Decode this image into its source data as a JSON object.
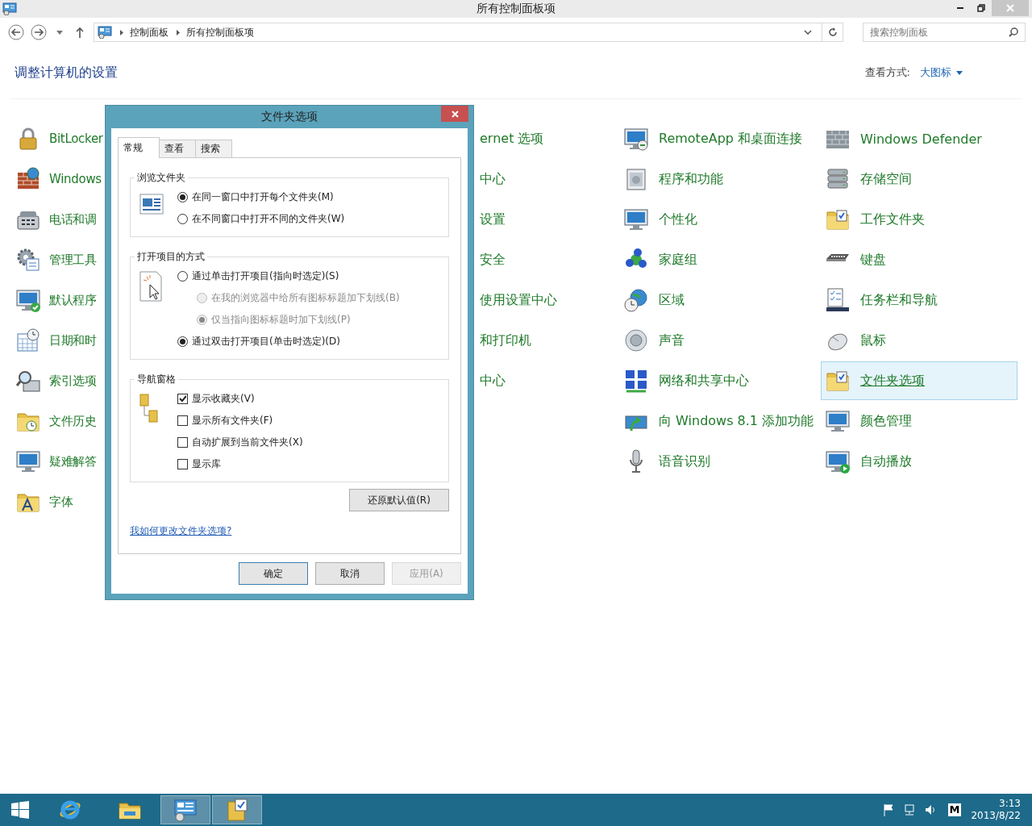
{
  "window": {
    "title": "所有控制面板项"
  },
  "navigation": {
    "breadcrumb": [
      "控制面板",
      "所有控制面板项"
    ],
    "search": {
      "placeholder": "搜索控制面板"
    }
  },
  "header": {
    "title": "调整计算机的设置",
    "view_label": "查看方式:",
    "view_value": "大图标"
  },
  "columns": [
    {
      "items": [
        {
          "label": "BitLocker",
          "selected": false
        },
        {
          "label": "Windows",
          "selected": false
        },
        {
          "label": "电话和调",
          "selected": false
        },
        {
          "label": "管理工具",
          "selected": false
        },
        {
          "label": "默认程序",
          "selected": false
        },
        {
          "label": "日期和时",
          "selected": false
        },
        {
          "label": "索引选项",
          "selected": false
        },
        {
          "label": "文件历史",
          "selected": false
        },
        {
          "label": "疑难解答",
          "selected": false
        },
        {
          "label": "字体",
          "selected": false
        }
      ]
    },
    {
      "items": [
        {
          "label": "ernet 选项",
          "selected": false
        },
        {
          "label": "中心",
          "selected": false
        },
        {
          "label": "设置",
          "selected": false
        },
        {
          "label": "安全",
          "selected": false
        },
        {
          "label": "使用设置中心",
          "selected": false
        },
        {
          "label": "和打印机",
          "selected": false
        },
        {
          "label": "中心",
          "selected": false
        }
      ]
    },
    {
      "items": [
        {
          "label": "RemoteApp 和桌面连接",
          "selected": false
        },
        {
          "label": "程序和功能",
          "selected": false
        },
        {
          "label": "个性化",
          "selected": false
        },
        {
          "label": "家庭组",
          "selected": false
        },
        {
          "label": "区域",
          "selected": false
        },
        {
          "label": "声音",
          "selected": false
        },
        {
          "label": "网络和共享中心",
          "selected": false
        },
        {
          "label": "向 Windows 8.1 添加功能",
          "selected": false
        },
        {
          "label": "语音识别",
          "selected": false
        }
      ]
    },
    {
      "items": [
        {
          "label": "Windows Defender",
          "selected": false
        },
        {
          "label": "存储空间",
          "selected": false
        },
        {
          "label": "工作文件夹",
          "selected": false
        },
        {
          "label": "键盘",
          "selected": false
        },
        {
          "label": "任务栏和导航",
          "selected": false
        },
        {
          "label": "鼠标",
          "selected": false
        },
        {
          "label": "文件夹选项",
          "selected": true
        },
        {
          "label": "颜色管理",
          "selected": false
        },
        {
          "label": "自动播放",
          "selected": false
        }
      ]
    }
  ],
  "dialog": {
    "title": "文件夹选项",
    "tabs": [
      {
        "label": "常规",
        "selected": true
      },
      {
        "label": "查看",
        "selected": false
      },
      {
        "label": "搜索",
        "selected": false
      }
    ],
    "groups": [
      {
        "title": "浏览文件夹",
        "options": [
          {
            "kind": "radio",
            "label": "在同一窗口中打开每个文件夹(M)",
            "checked": true,
            "disabled": false
          },
          {
            "kind": "radio",
            "label": "在不同窗口中打开不同的文件夹(W)",
            "checked": false,
            "disabled": false
          }
        ]
      },
      {
        "title": "打开项目的方式",
        "options": [
          {
            "kind": "radio",
            "label": "通过单击打开项目(指向时选定)(S)",
            "checked": false,
            "disabled": false,
            "children": [
              {
                "kind": "radio",
                "label": "在我的浏览器中给所有图标标题加下划线(B)",
                "checked": false,
                "disabled": true
              },
              {
                "kind": "radio",
                "label": "仅当指向图标标题时加下划线(P)",
                "checked": true,
                "disabled": true
              }
            ]
          },
          {
            "kind": "radio",
            "label": "通过双击打开项目(单击时选定)(D)",
            "checked": true,
            "disabled": false
          }
        ]
      },
      {
        "title": "导航窗格",
        "options": [
          {
            "kind": "checkbox",
            "label": "显示收藏夹(V)",
            "checked": true,
            "disabled": false
          },
          {
            "kind": "checkbox",
            "label": "显示所有文件夹(F)",
            "checked": false,
            "disabled": false
          },
          {
            "kind": "checkbox",
            "label": "自动扩展到当前文件夹(X)",
            "checked": false,
            "disabled": false
          },
          {
            "kind": "checkbox",
            "label": "显示库",
            "checked": false,
            "disabled": false
          }
        ]
      }
    ],
    "restore_button": "还原默认值(R)",
    "help_link": "我如何更改文件夹选项?",
    "buttons": [
      {
        "label": "确定",
        "default": true,
        "disabled": false
      },
      {
        "label": "取消",
        "default": false,
        "disabled": false
      },
      {
        "label": "应用(A)",
        "default": false,
        "disabled": true
      }
    ]
  },
  "taskbar": {
    "apps": [
      {
        "selected": false
      },
      {
        "selected": false
      },
      {
        "selected": true
      },
      {
        "selected": true
      }
    ],
    "ime": "M",
    "time": "3:13",
    "date": "2013/8/22"
  }
}
